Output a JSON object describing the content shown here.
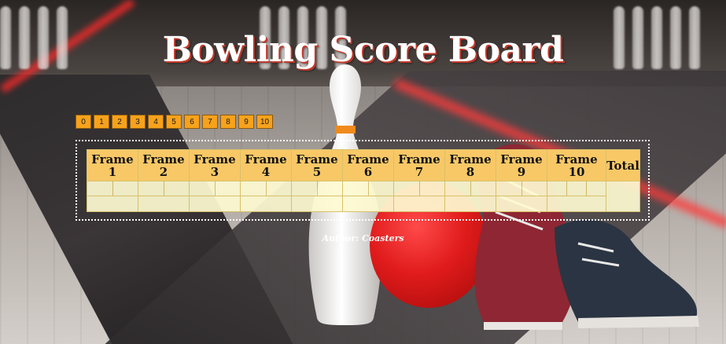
{
  "header": {
    "title": "Bowling Score Board"
  },
  "pin_buttons": [
    "0",
    "1",
    "2",
    "3",
    "4",
    "5",
    "6",
    "7",
    "8",
    "9",
    "10"
  ],
  "scoreboard": {
    "frames": [
      {
        "word": "Frame",
        "number": "1"
      },
      {
        "word": "Frame",
        "number": "2"
      },
      {
        "word": "Frame",
        "number": "3"
      },
      {
        "word": "Frame",
        "number": "4"
      },
      {
        "word": "Frame",
        "number": "5"
      },
      {
        "word": "Frame",
        "number": "6"
      },
      {
        "word": "Frame",
        "number": "7"
      },
      {
        "word": "Frame",
        "number": "8"
      },
      {
        "word": "Frame",
        "number": "9"
      },
      {
        "word": "Frame",
        "number": "10"
      }
    ],
    "total_label": "Total"
  },
  "footer": {
    "author": "Author: Coasters"
  },
  "colors": {
    "button_bg": "#f7a21b",
    "header_bg": "#f8c866",
    "cell_bg": "#fefbd2",
    "title_shadow": "#c0392b"
  }
}
